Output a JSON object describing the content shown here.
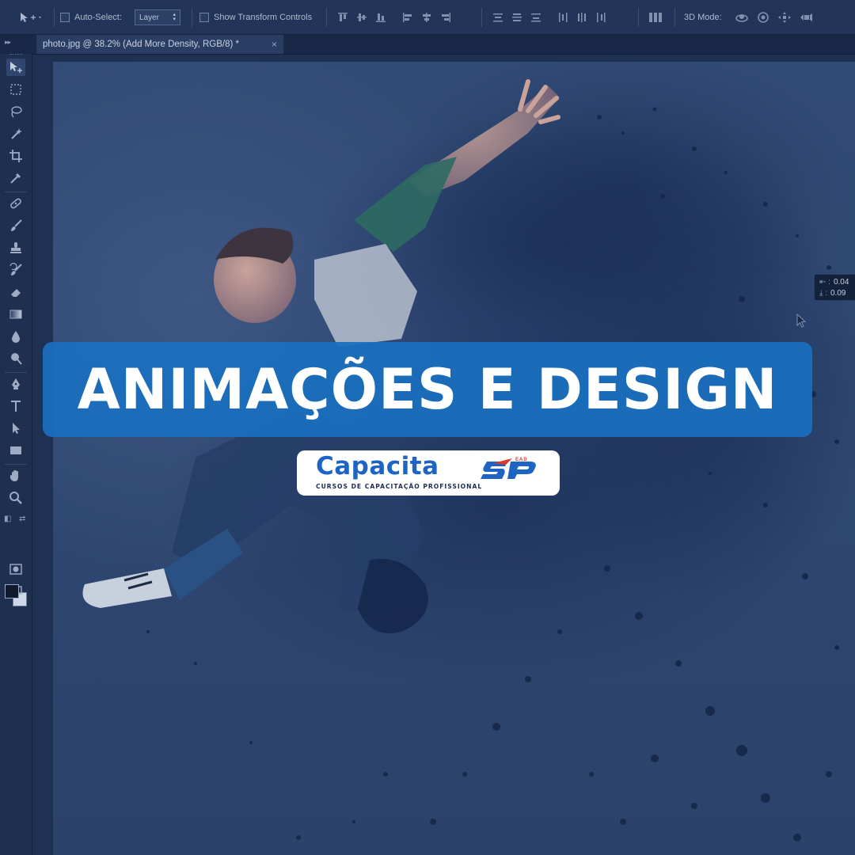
{
  "options_bar": {
    "auto_select_label": "Auto-Select:",
    "layer_select_value": "Layer",
    "show_transform_label": "Show Transform Controls",
    "mode_3d_label": "3D Mode:"
  },
  "document_tab": {
    "title": "photo.jpg @ 38.2% (Add More Density, RGB/8) *",
    "close_glyph": "×"
  },
  "tools": [
    "move-tool",
    "marquee-tool",
    "lasso-tool",
    "magic-wand-tool",
    "crop-tool",
    "eyedropper-tool",
    "healing-brush-tool",
    "brush-tool",
    "clone-stamp-tool",
    "history-brush-tool",
    "eraser-tool",
    "gradient-tool",
    "blur-tool",
    "dodge-tool",
    "pen-tool",
    "type-tool",
    "path-selection-tool",
    "rectangle-tool",
    "hand-tool",
    "zoom-tool"
  ],
  "colors": {
    "foreground": "#111a2d",
    "background": "#cfd8e8",
    "banner": "#1a6fbe",
    "logo_blue": "#1e64c3",
    "logo_red": "#e0392b"
  },
  "measure_hud": {
    "dx_label": "⇤ :",
    "dx_value": "0.04",
    "dy_label": "⤓ :",
    "dy_value": "0.09"
  },
  "headline": "ANIMAÇÕES E DESIGN",
  "logo": {
    "word": "Capacita",
    "sp": "SP",
    "ead": "EAD",
    "subtitle": "CURSOS DE CAPACITAÇÃO PROFISSIONAL"
  }
}
